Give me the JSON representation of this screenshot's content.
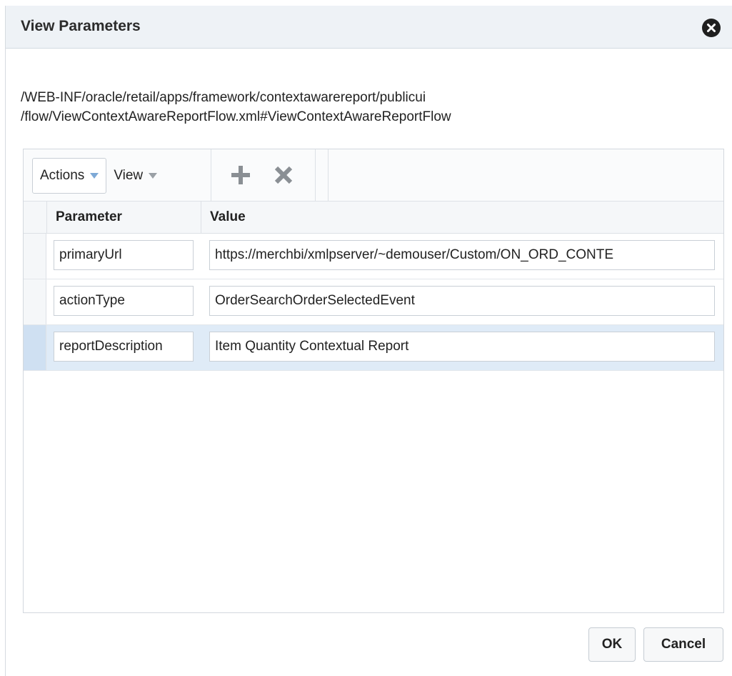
{
  "dialog": {
    "title": "View Parameters",
    "close_icon": "close-circle-icon"
  },
  "flow_path": {
    "line1": "/WEB-INF/oracle/retail/apps/framework/contextawarereport/publicui",
    "line2": "/flow/ViewContextAwareReportFlow.xml#ViewContextAwareReportFlow"
  },
  "toolbar": {
    "actions_label": "Actions",
    "view_label": "View",
    "add_icon": "plus-icon",
    "delete_icon": "x-icon"
  },
  "table": {
    "columns": [
      "Parameter",
      "Value"
    ],
    "rows": [
      {
        "parameter": "primaryUrl",
        "value": "https://merchbi/xmlpserver/~demouser/Custom/ON_ORD_CONTE"
      },
      {
        "parameter": "actionType",
        "value": "OrderSearchOrderSelectedEvent"
      },
      {
        "parameter": "reportDescription",
        "value": "Item Quantity Contextual Report"
      }
    ],
    "selected_row_index": 2
  },
  "footer": {
    "ok_label": "OK",
    "cancel_label": "Cancel"
  },
  "colors": {
    "titlebar_bg": "#eef2f6",
    "selected_row_bg": "#dfebf7",
    "caret_blue": "#7ea9d6"
  }
}
